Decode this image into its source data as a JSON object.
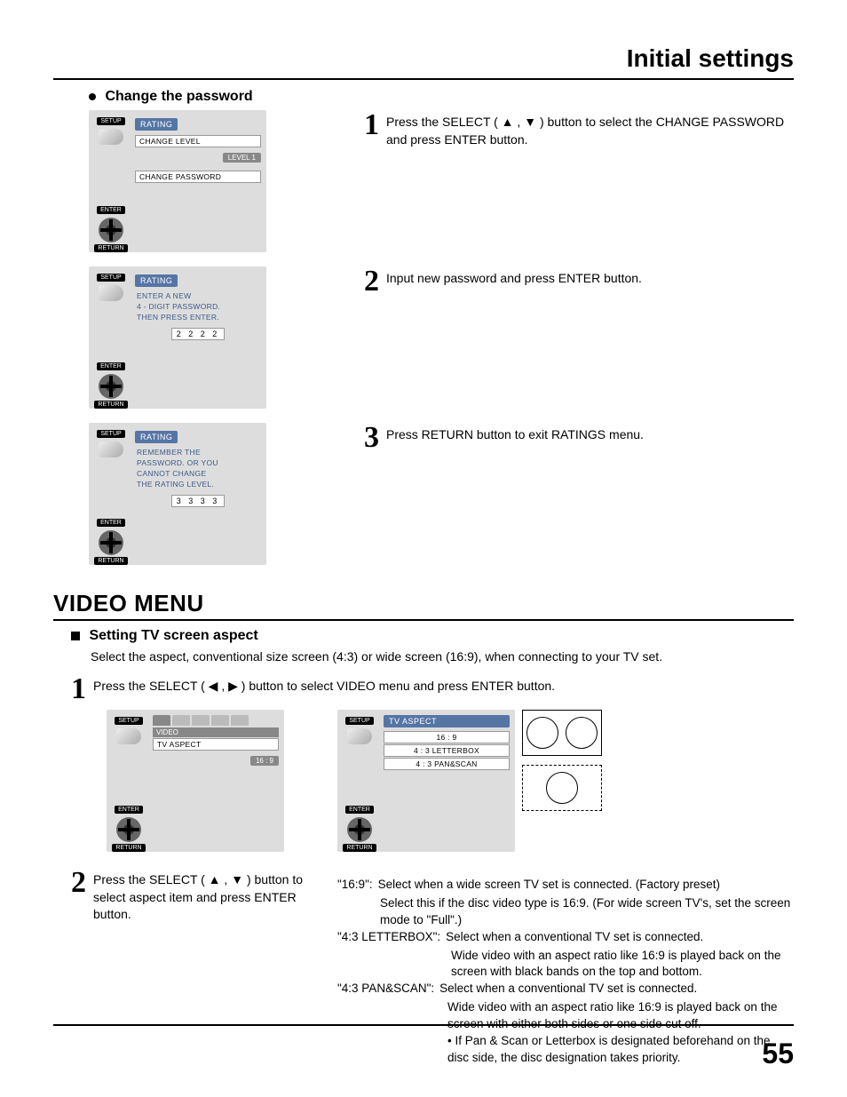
{
  "header": {
    "title": "Initial settings"
  },
  "change_password": {
    "heading": "Change the password",
    "steps": [
      {
        "num": "1",
        "text": "Press the SELECT ( ▲ , ▼ ) button to select the CHANGE PASSWORD and press ENTER button.",
        "osd": {
          "title": "RATING",
          "lines": [
            "CHANGE  LEVEL"
          ],
          "badge": "LEVEL  1",
          "lines2": [
            "CHANGE  PASSWORD"
          ],
          "setup": "SETUP",
          "enter": "ENTER",
          "return": "RETURN"
        }
      },
      {
        "num": "2",
        "text": "Input new password and press ENTER button.",
        "osd": {
          "title": "RATING",
          "msg": [
            "ENTER  A  NEW",
            "4 - DIGIT  PASSWORD.",
            "THEN  PRESS  ENTER."
          ],
          "input": "2 2 2 2",
          "setup": "SETUP",
          "enter": "ENTER",
          "return": "RETURN"
        }
      },
      {
        "num": "3",
        "text": "Press RETURN  button to exit RATINGS menu.",
        "osd": {
          "title": "RATING",
          "msg": [
            "REMEMBER THE",
            "PASSWORD. OR YOU",
            "CANNOT CHANGE",
            "THE RATING LEVEL."
          ],
          "input": "3 3 3 3",
          "setup": "SETUP",
          "enter": "ENTER",
          "return": "RETURN"
        }
      }
    ]
  },
  "video_menu": {
    "title": "VIDEO MENU",
    "subheading": "Setting TV screen aspect",
    "desc": "Select the aspect, conventional size screen (4:3) or wide screen (16:9), when connecting to your TV set.",
    "step1": {
      "num": "1",
      "text": "Press the SELECT ( ◀ , ▶ ) button to select VIDEO menu and press ENTER button.",
      "osd": {
        "tab": "VIDEO",
        "item": "TV ASPECT",
        "value": "16 : 9",
        "setup": "SETUP",
        "enter": "ENTER",
        "return": "RETURN"
      }
    },
    "step2": {
      "num": "2",
      "text": "Press the SELECT ( ▲ , ▼ ) button to select aspect item and press ENTER button.",
      "osd": {
        "title": "TV ASPECT",
        "options": [
          "16 : 9",
          "4 : 3 LETTERBOX",
          "4 : 3 PAN&SCAN"
        ],
        "setup": "SETUP",
        "enter": "ENTER",
        "return": "RETURN"
      }
    },
    "defs": {
      "d169_label": "\"16:9\":",
      "d169_l1": "Select when a wide screen TV set is connected. (Factory preset)",
      "d169_l2": "Select this if the disc video type is 16:9. (For wide screen TV's, set the screen mode to \"Full\".)",
      "dlb_label": "\"4:3 LETTERBOX\":",
      "dlb_l1": "Select when a conventional TV set is connected.",
      "dlb_l2": "Wide video with an aspect ratio like 16:9 is played back on the screen with black bands on the top and bottom.",
      "dps_label": "\"4:3 PAN&SCAN\":",
      "dps_l1": "Select when a conventional TV set is connected.",
      "dps_l2": "Wide video with an aspect ratio like 16:9 is played back on the screen with either both sides or one side cut off.",
      "dps_l3": "• If Pan & Scan or Letterbox is designated beforehand on the disc side, the disc designation takes priority."
    }
  },
  "page_number": "55"
}
